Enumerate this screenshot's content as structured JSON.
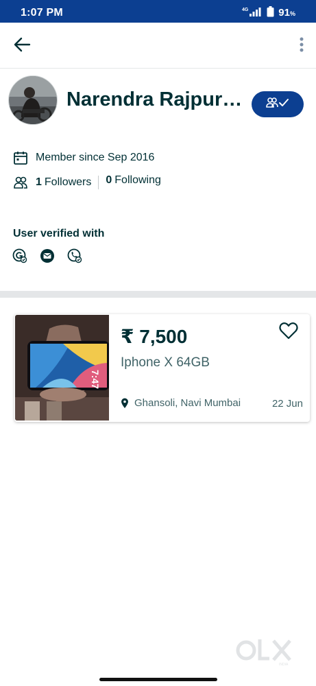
{
  "status_bar": {
    "time": "1:07 PM",
    "network": "4G",
    "battery": "91",
    "battery_unit": "%"
  },
  "app_bar": {
    "back_icon": "arrow-left-icon",
    "menu_icon": "more-vertical-icon"
  },
  "profile": {
    "name": "Narendra Rajpuro...",
    "member_since": "Member since Sep 2016",
    "followers_count": "1",
    "followers_label": "Followers",
    "following_count": "0",
    "following_label": "Following",
    "verified_title": "User verified with",
    "verified_methods": [
      "google-icon",
      "email-icon",
      "phone-icon"
    ],
    "follow_button_icon": "user-following-check-icon"
  },
  "listings": [
    {
      "price": "₹ 7,500",
      "title": "Iphone X 64GB",
      "location": "Ghansoli, Navi Mumbai",
      "date": "22 Jun",
      "favorite_icon": "heart-outline-icon"
    }
  ],
  "brand": {
    "watermark": "OLX",
    "accent_color": "#0c3f91",
    "text_color": "#002f34"
  }
}
